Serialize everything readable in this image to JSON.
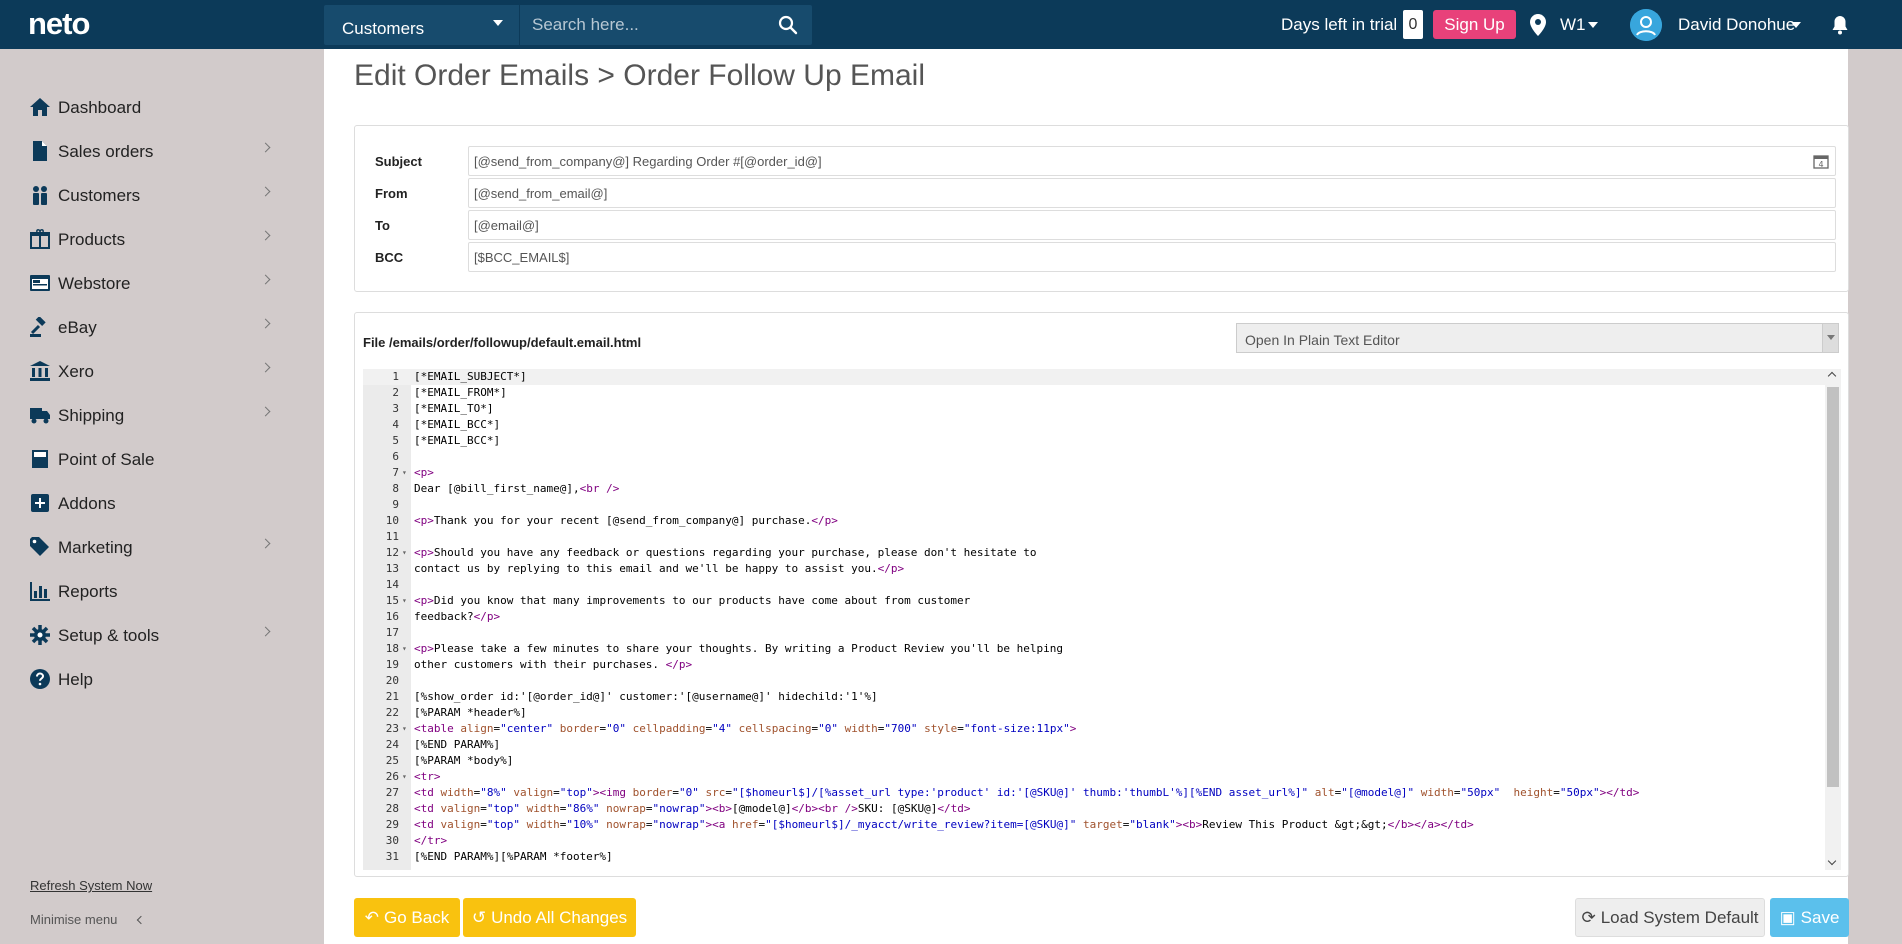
{
  "header": {
    "logo": "neto",
    "search_scope": "Customers",
    "search_placeholder": "Search here...",
    "trial_label": "Days left in trial",
    "trial_days": "0",
    "signup_label": "Sign Up",
    "location": "W1",
    "user_name": "David Donohue"
  },
  "sidebar": {
    "items": [
      {
        "label": "Dashboard",
        "icon": "home-icon"
      },
      {
        "label": "Sales orders",
        "icon": "document-icon"
      },
      {
        "label": "Customers",
        "icon": "users-icon"
      },
      {
        "label": "Products",
        "icon": "box-icon"
      },
      {
        "label": "Webstore",
        "icon": "webstore-icon"
      },
      {
        "label": "eBay",
        "icon": "gavel-icon"
      },
      {
        "label": "Xero",
        "icon": "bank-icon"
      },
      {
        "label": "Shipping",
        "icon": "truck-icon"
      },
      {
        "label": "Point of Sale",
        "icon": "pos-icon"
      },
      {
        "label": "Addons",
        "icon": "plus-square-icon"
      },
      {
        "label": "Marketing",
        "icon": "tag-icon"
      },
      {
        "label": "Reports",
        "icon": "chart-icon"
      },
      {
        "label": "Setup & tools",
        "icon": "gear-icon"
      },
      {
        "label": "Help",
        "icon": "help-icon"
      }
    ],
    "refresh_label": "Refresh System Now",
    "minimise_label": "Minimise menu"
  },
  "main": {
    "title": "Edit Order Emails > Order Follow Up Email",
    "fields": {
      "subject_label": "Subject",
      "subject_value": "[@send_from_company@] Regarding Order #[@order_id@]",
      "from_label": "From",
      "from_value": "[@send_from_email@]",
      "to_label": "To",
      "to_value": "[@email@]",
      "bcc_label": "BCC",
      "bcc_value": "[$BCC_EMAIL$]"
    },
    "editor": {
      "file_label": "File /emails/order/followup/default.email.html",
      "editor_mode": "Open In Plain Text Editor",
      "lines": [
        "[*EMAIL_SUBJECT*]",
        "[*EMAIL_FROM*]",
        "[*EMAIL_TO*]",
        "[*EMAIL_BCC*]",
        "[*EMAIL_BCC*]",
        "",
        "<p>",
        "Dear [@bill_first_name@],<br />",
        "",
        "<p>Thank you for your recent [@send_from_company@] purchase.</p>",
        "",
        "<p>Should you have any feedback or questions regarding your purchase, please don't hesitate to",
        "contact us by replying to this email and we'll be happy to assist you.</p>",
        "",
        "<p>Did you know that many improvements to our products have come about from customer",
        "feedback?</p>",
        "",
        "<p>Please take a few minutes to share your thoughts. By writing a Product Review you'll be helping",
        "other customers with their purchases. </p>",
        "",
        "[%show_order id:'[@order_id@]' customer:'[@username@]' hidechild:'1'%]",
        "[%PARAM *header%]",
        "<table align=\"center\" border=\"0\" cellpadding=\"4\" cellspacing=\"0\" width=\"700\" style=\"font-size:11px\">",
        "[%END PARAM%]",
        "[%PARAM *body%]",
        "<tr>",
        "<td width=\"8%\" valign=\"top\"><img border=\"0\" src=\"[$homeurl$]/[%asset_url type:'product' id:'[@SKU@]' thumb:'thumbL'%][%END asset_url%]\" alt=\"[@model@]\" width=\"50px\"  height=\"50px\"></td>",
        "<td valign=\"top\" width=\"86%\" nowrap=\"nowrap\"><b>[@model@]</b><br />SKU: [@SKU@]</td>",
        "<td valign=\"top\" width=\"10%\" nowrap=\"nowrap\"><a href=\"[$homeurl$]/_myacct/write_review?item=[@SKU@]\" target=\"blank\"><b>Review This Product &gt;&gt;</b></a></td>",
        "</tr>",
        "[%END PARAM%][%PARAM *footer%]"
      ],
      "fold_lines": [
        7,
        12,
        15,
        18,
        23,
        26
      ]
    },
    "buttons": {
      "back": "Go Back",
      "undo": "Undo All Changes",
      "load_default": "Load System Default",
      "save": "Save"
    }
  },
  "colors": {
    "topbar": "#0c3a59",
    "accent_pink": "#e8417a",
    "warning_yellow": "#f9c20f",
    "info_blue": "#5bc0ec"
  }
}
